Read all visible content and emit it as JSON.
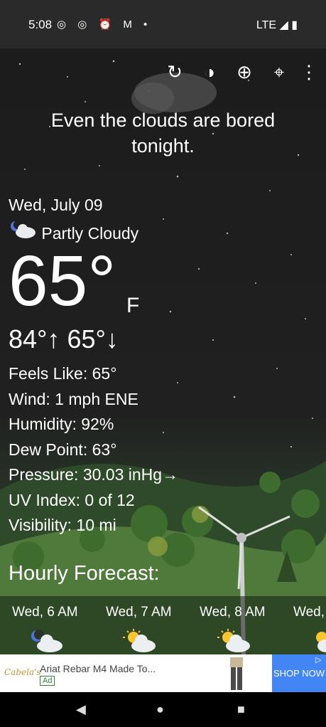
{
  "status_bar": {
    "time": "5:08",
    "notif_icons": "◎ ◎ ⏰ M •",
    "network": "LTE ◢ ▮"
  },
  "toolbar": {
    "refresh": "↻",
    "theme": "◑",
    "add": "⊕",
    "location": "⌖",
    "more": "⋮"
  },
  "tagline": [
    "Even the clouds are bored",
    "tonight."
  ],
  "current": {
    "date": "Wed, July 09",
    "condition": "Partly Cloudy",
    "temp": "65°",
    "unit": "F",
    "hilo": "84°↑ 65°↓"
  },
  "details": [
    "Feels Like:  65°",
    "Wind:  1 mph ENE",
    "Humidity:  92%",
    "Dew Point:  63°",
    "Pressure:  30.03 inHg→",
    "UV Index:  0 of 12",
    "Visibility:  10 mi"
  ],
  "hourly": {
    "title": "Hourly Forecast:",
    "items": [
      {
        "time": "Wed, 6 AM",
        "icon": "night-partly-cloudy-icon"
      },
      {
        "time": "Wed, 7 AM",
        "icon": "sun-cloud-icon"
      },
      {
        "time": "Wed, 8 AM",
        "icon": "sun-cloud-icon"
      },
      {
        "time": "Wed,",
        "icon": "sun-cloud-icon"
      }
    ]
  },
  "ad": {
    "logo": "Cabela's",
    "title": "Ariat Rebar M4 Made To...",
    "badge": "Ad",
    "cta": "SHOP NOW",
    "cta_color": "#4285f4"
  },
  "nav": {
    "back": "◀",
    "home": "●",
    "recents": "■"
  }
}
